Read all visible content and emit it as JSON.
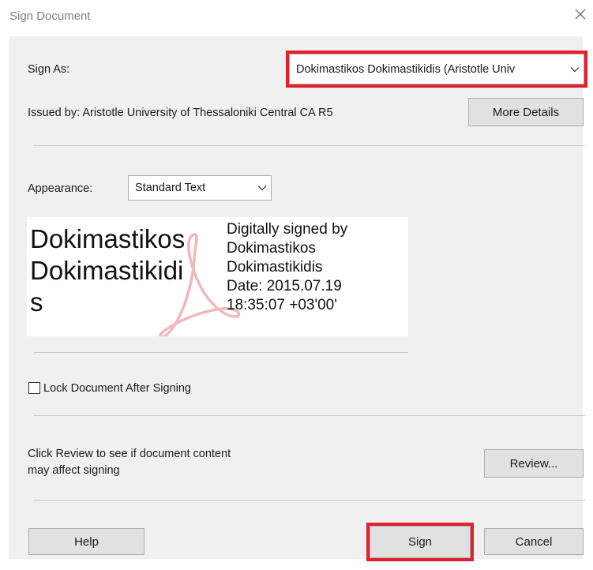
{
  "dialog": {
    "title": "Sign Document"
  },
  "sign_as": {
    "label": "Sign As:",
    "value": "Dokimastikos Dokimastikidis (Aristotle Univ"
  },
  "issuer": {
    "text": "Issued by: Aristotle University of Thessaloniki Central CA R5",
    "more_details_label": "More Details"
  },
  "appearance": {
    "label": "Appearance:",
    "value": "Standard Text"
  },
  "signature_preview": {
    "name_lines": "Dokimastikos\nDokimastikidi\ns",
    "detail_lines": [
      "Digitally signed by",
      "Dokimastikos",
      "Dokimastikidis",
      "Date: 2015.07.19",
      "18:35:07 +03'00'"
    ]
  },
  "lock": {
    "label": "Lock Document After Signing",
    "checked": false
  },
  "review": {
    "text_line1": "Click Review to see if document content",
    "text_line2": "may affect signing",
    "button_label": "Review..."
  },
  "footer": {
    "help_label": "Help",
    "sign_label": "Sign",
    "cancel_label": "Cancel"
  },
  "colors": {
    "highlight": "#e0202a",
    "panel": "#f0f0f0",
    "button": "#e1e1e1"
  }
}
